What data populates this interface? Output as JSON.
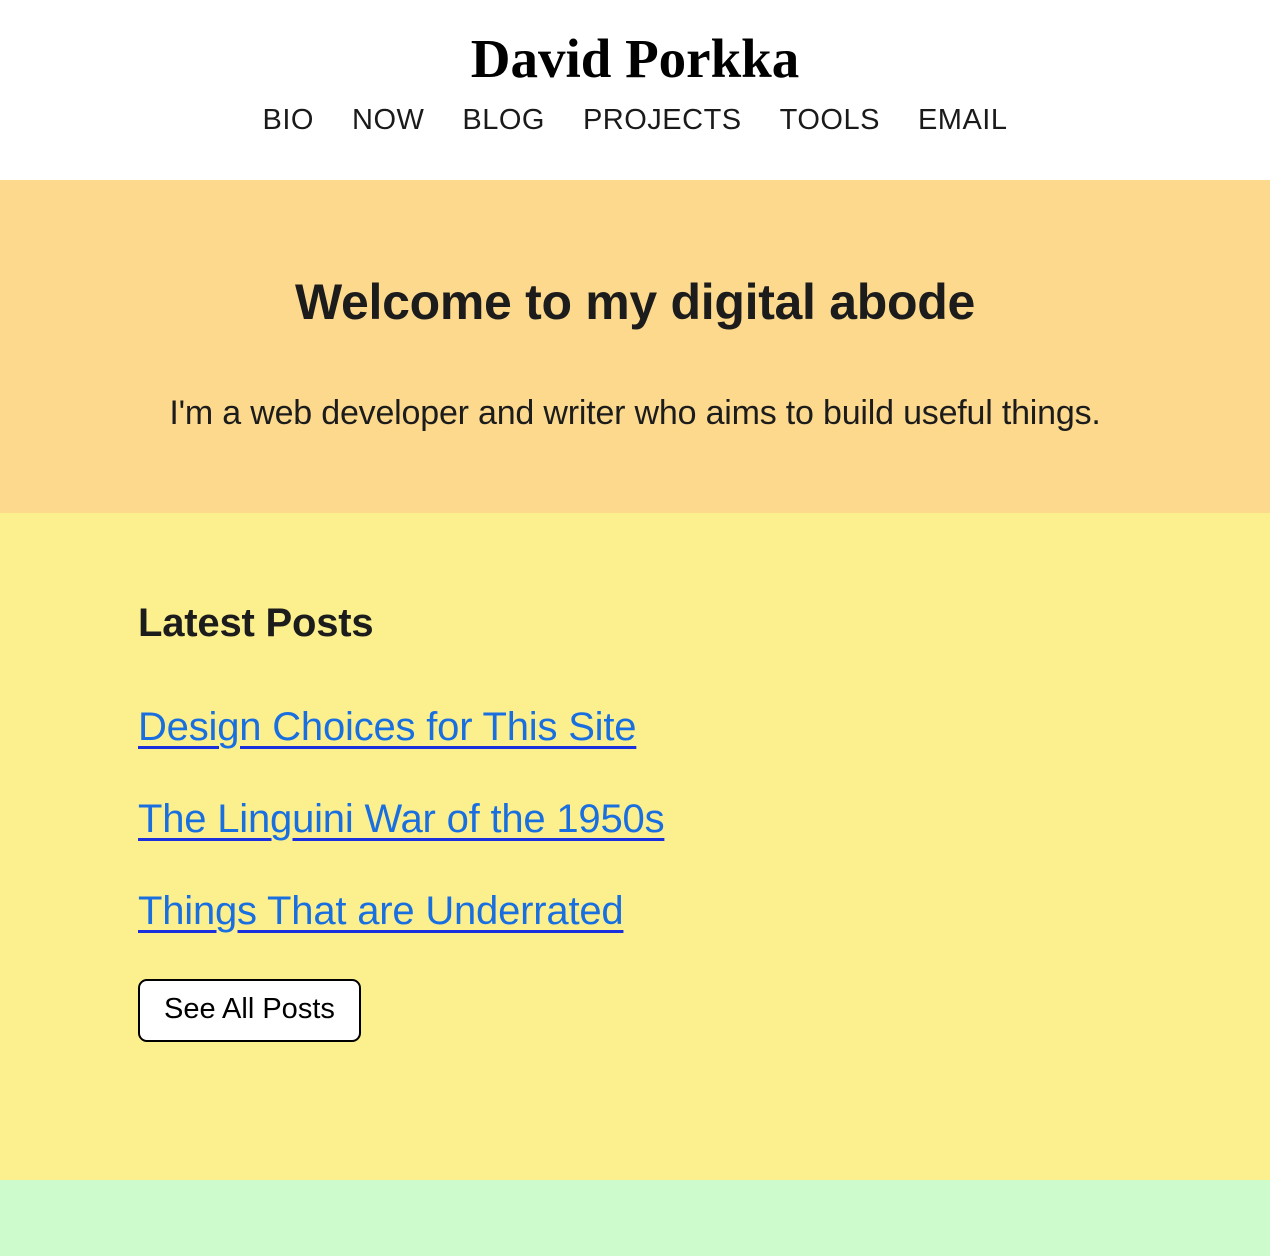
{
  "header": {
    "site_title": "David Porkka",
    "nav": [
      {
        "label": "BIO",
        "name": "nav-link-bio"
      },
      {
        "label": "NOW",
        "name": "nav-link-now"
      },
      {
        "label": "BLOG",
        "name": "nav-link-blog"
      },
      {
        "label": "PROJECTS",
        "name": "nav-link-projects"
      },
      {
        "label": "TOOLS",
        "name": "nav-link-tools"
      },
      {
        "label": "EMAIL",
        "name": "nav-link-email"
      }
    ]
  },
  "hero": {
    "title": "Welcome to my digital abode",
    "subtitle": "I'm a web developer and writer who aims to build useful things."
  },
  "posts": {
    "heading": "Latest Posts",
    "items": [
      {
        "title": "Design Choices for This Site"
      },
      {
        "title": "The Linguini War of the 1950s"
      },
      {
        "title": "Things That are Underrated"
      }
    ],
    "see_all_label": "See All Posts"
  },
  "colors": {
    "hero_background": "#fcd98c",
    "posts_background": "#fcf08e",
    "footer_background": "#cdfbcb",
    "link": "#1a6fe0",
    "link_underline": "#1b31dd",
    "text": "#1c1c1c",
    "header_background": "#ffffff",
    "button_background": "#ffffff",
    "button_border": "#000000"
  }
}
